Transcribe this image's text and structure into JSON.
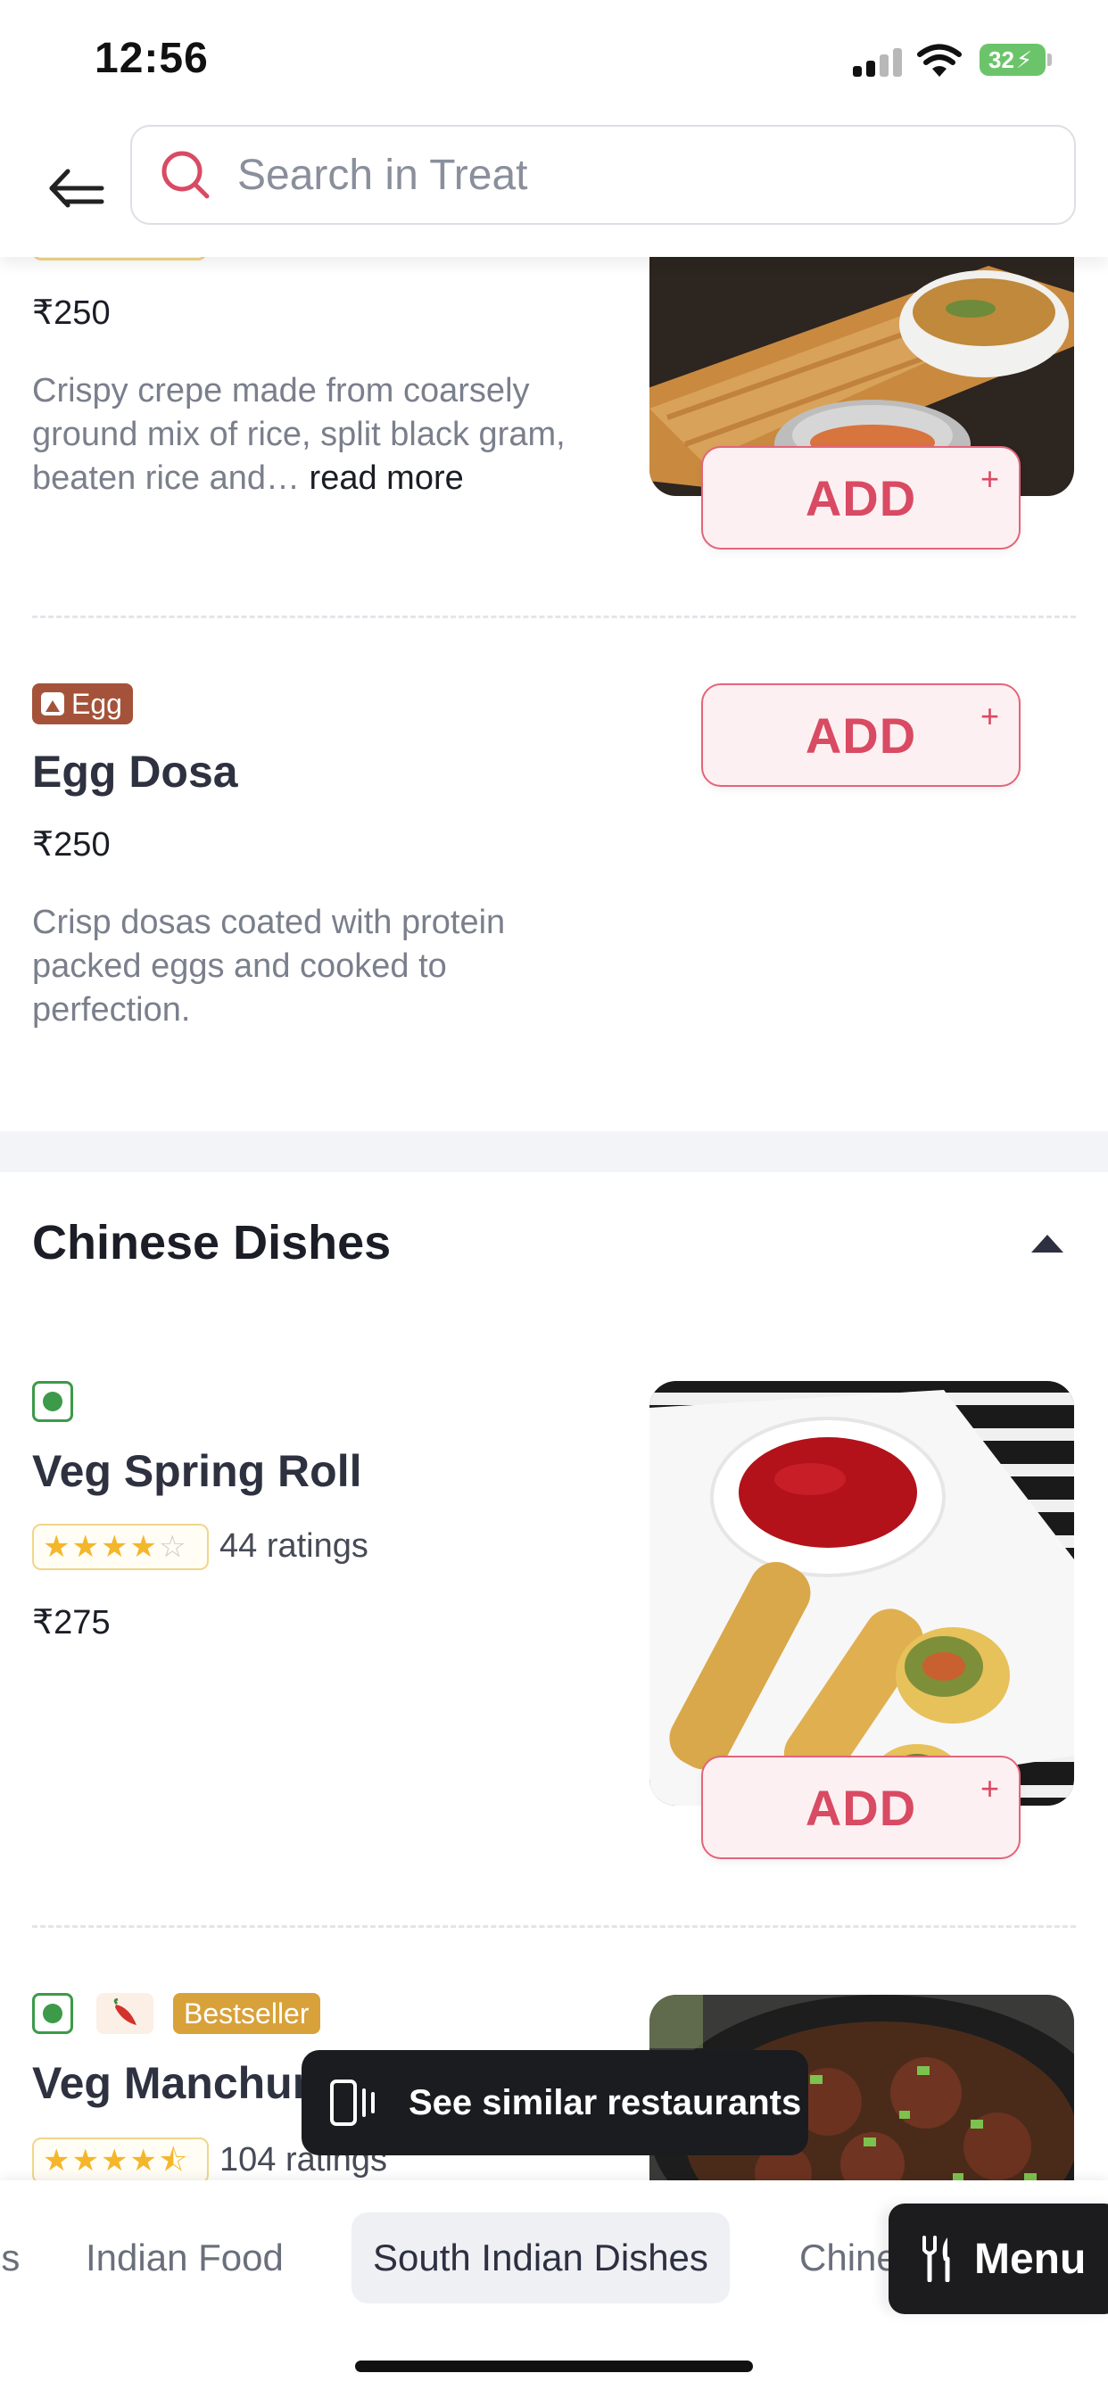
{
  "status_bar": {
    "time": "12:56",
    "battery": "32"
  },
  "search": {
    "placeholder": "Search in Treat"
  },
  "items_top": {
    "dosa": {
      "price": "₹250",
      "description": "Crispy crepe made from coarsely ground mix of rice, split black gram, beaten rice and…",
      "read_more": "read more",
      "add_label": "ADD"
    },
    "egg_dosa": {
      "tag": "Egg",
      "name": "Egg Dosa",
      "price": "₹250",
      "description": "Crisp dosas coated with protein packed eggs and cooked to perfection.",
      "add_label": "ADD"
    }
  },
  "section": {
    "title": "Chinese Dishes"
  },
  "items_chinese": {
    "spring_roll": {
      "name": "Veg Spring Roll",
      "rating": 4,
      "ratings_count": "44 ratings",
      "price": "₹275",
      "add_label": "ADD"
    },
    "manchurian": {
      "badge": "Bestseller",
      "name": "Veg Manchurian",
      "rating": 4.5,
      "ratings_count": "104 ratings"
    }
  },
  "toast": {
    "label": "See similar restaurants"
  },
  "bottom_nav": {
    "categories": [
      "os",
      "Indian Food",
      "South Indian Dishes",
      "Chinese Dishes"
    ],
    "active": "South Indian Dishes",
    "menu_label": "Menu"
  },
  "colors": {
    "brand": "#d94a63",
    "veg": "#3c9a49",
    "egg": "#a4533a",
    "bestseller": "#d8a13a"
  }
}
